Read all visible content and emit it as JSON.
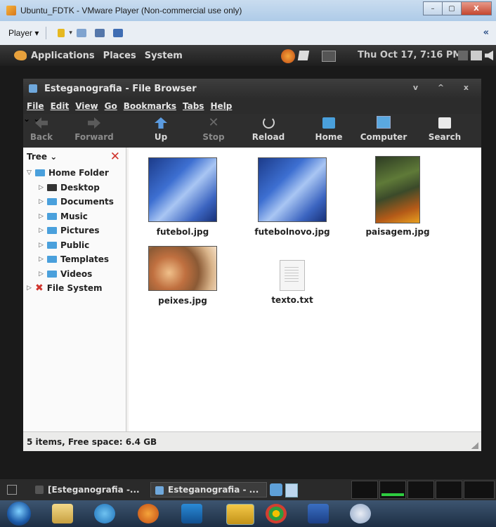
{
  "vm": {
    "title": "Ubuntu_FDTK - VMware Player (Non-commercial use only)",
    "player_label": "Player",
    "minimize": "–",
    "maximize": "▢",
    "close": "X",
    "collapse": "«"
  },
  "gnome_panel": {
    "menus": [
      "Applications",
      "Places",
      "System"
    ],
    "clock": "Thu Oct 17,  7:16 PM"
  },
  "nautilus": {
    "title": "Esteganografia - File Browser",
    "window_controls": "v ^ x",
    "menu": [
      "File",
      "Edit",
      "View",
      "Go",
      "Bookmarks",
      "Tabs",
      "Help"
    ],
    "toolbar": {
      "back": "Back",
      "forward": "Forward",
      "up": "Up",
      "stop": "Stop",
      "reload": "Reload",
      "home": "Home",
      "computer": "Computer",
      "search": "Search"
    },
    "sidebar": {
      "mode": "Tree",
      "close": "✕",
      "root": "Home Folder",
      "children": [
        "Desktop",
        "Documents",
        "Music",
        "Pictures",
        "Public",
        "Templates",
        "Videos"
      ],
      "filesystem": "File System"
    },
    "files": [
      "futebol.jpg",
      "futebolnovo.jpg",
      "paisagem.jpg",
      "peixes.jpg",
      "texto.txt"
    ],
    "status": "5 items, Free space: 6.4 GB"
  },
  "bottom_panel": {
    "task1": "[Esteganografia -...",
    "task2": "Esteganografia - ..."
  },
  "colors": {
    "panel": "#2a2a2a",
    "folder": "#4aa0dc",
    "accent_close": "#d0332c"
  }
}
